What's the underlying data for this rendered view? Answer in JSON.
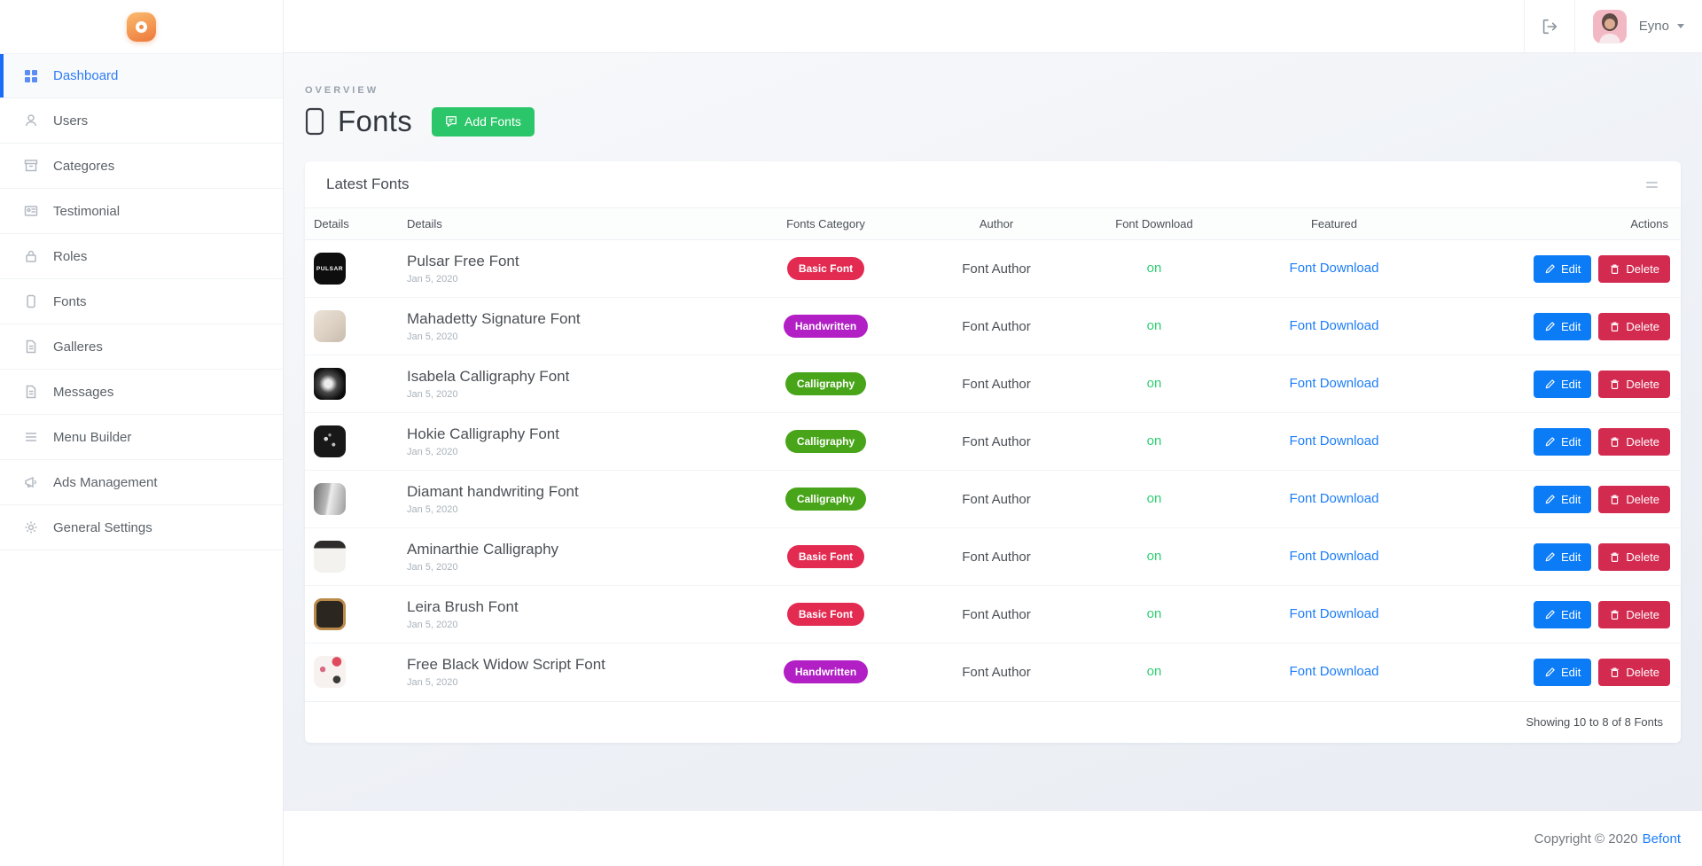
{
  "topbar": {
    "user_name": "Eyno"
  },
  "sidebar": {
    "items": [
      {
        "label": "Dashboard",
        "icon": "grid-icon",
        "active": true
      },
      {
        "label": "Users",
        "icon": "user-icon",
        "active": false
      },
      {
        "label": "Categores",
        "icon": "archive-icon",
        "active": false
      },
      {
        "label": "Testimonial",
        "icon": "testimonial-icon",
        "active": false
      },
      {
        "label": "Roles",
        "icon": "lock-icon",
        "active": false
      },
      {
        "label": "Fonts",
        "icon": "tablet-icon",
        "active": false
      },
      {
        "label": "Galleres",
        "icon": "file-icon",
        "active": false
      },
      {
        "label": "Messages",
        "icon": "file-icon",
        "active": false
      },
      {
        "label": "Menu Builder",
        "icon": "list-icon",
        "active": false
      },
      {
        "label": "Ads Management",
        "icon": "megaphone-icon",
        "active": false
      },
      {
        "label": "General Settings",
        "icon": "gear-icon",
        "active": false
      }
    ]
  },
  "page": {
    "overview_label": "OVERVIEW",
    "title": "Fonts",
    "add_button": "Add Fonts"
  },
  "card": {
    "title": "Latest Fonts",
    "columns": [
      "Details",
      "Details",
      "Fonts Category",
      "Author",
      "Font Download",
      "Featured",
      "Actions"
    ],
    "actions": {
      "edit": "Edit",
      "delete": "Delete"
    },
    "footer": "Showing 10 to 8 of 8 Fonts",
    "rows": [
      {
        "title": "Pulsar Free Font",
        "date": "Jan 5, 2020",
        "category": "Basic Font",
        "category_color": "#e32a51",
        "author": "Font Author",
        "download_status": "on",
        "featured": "Font Download",
        "thumb": "pulsar",
        "thumb_text": "PULSAR"
      },
      {
        "title": "Mahadetty Signature Font",
        "date": "Jan 5, 2020",
        "category": "Handwritten",
        "category_color": "#b11fc5",
        "author": "Font Author",
        "download_status": "on",
        "featured": "Font Download",
        "thumb": "mahadetty",
        "thumb_text": ""
      },
      {
        "title": "Isabela Calligraphy Font",
        "date": "Jan 5, 2020",
        "category": "Calligraphy",
        "category_color": "#48a519",
        "author": "Font Author",
        "download_status": "on",
        "featured": "Font Download",
        "thumb": "isabela",
        "thumb_text": ""
      },
      {
        "title": "Hokie Calligraphy Font",
        "date": "Jan 5, 2020",
        "category": "Calligraphy",
        "category_color": "#48a519",
        "author": "Font Author",
        "download_status": "on",
        "featured": "Font Download",
        "thumb": "hokie",
        "thumb_text": ""
      },
      {
        "title": "Diamant handwriting Font",
        "date": "Jan 5, 2020",
        "category": "Calligraphy",
        "category_color": "#48a519",
        "author": "Font Author",
        "download_status": "on",
        "featured": "Font Download",
        "thumb": "diamant",
        "thumb_text": ""
      },
      {
        "title": "Aminarthie Calligraphy",
        "date": "Jan 5, 2020",
        "category": "Basic Font",
        "category_color": "#e32a51",
        "author": "Font Author",
        "download_status": "on",
        "featured": "Font Download",
        "thumb": "aminarthie",
        "thumb_text": ""
      },
      {
        "title": "Leira Brush Font",
        "date": "Jan 5, 2020",
        "category": "Basic Font",
        "category_color": "#e32a51",
        "author": "Font Author",
        "download_status": "on",
        "featured": "Font Download",
        "thumb": "leira",
        "thumb_text": ""
      },
      {
        "title": "Free Black Widow Script Font",
        "date": "Jan 5, 2020",
        "category": "Handwritten",
        "category_color": "#b11fc5",
        "author": "Font Author",
        "download_status": "on",
        "featured": "Font Download",
        "thumb": "blackwidow",
        "thumb_text": ""
      }
    ]
  },
  "footer": {
    "copyright": "Copyright © 2020",
    "brand_link": "Befont"
  },
  "colors": {
    "accent_blue": "#2e7cf6",
    "active_bar_blue": "#1b6df5",
    "add_button_green": "#2bc669",
    "badge_red": "#e32a51",
    "badge_purple": "#b11fc5",
    "badge_green": "#48a519",
    "status_on_green": "#2fce71",
    "link_blue": "#1d7ef7",
    "edit_blue": "#0b7cf6",
    "delete_red": "#d32b50",
    "logo_orange": "#ee7f40"
  }
}
